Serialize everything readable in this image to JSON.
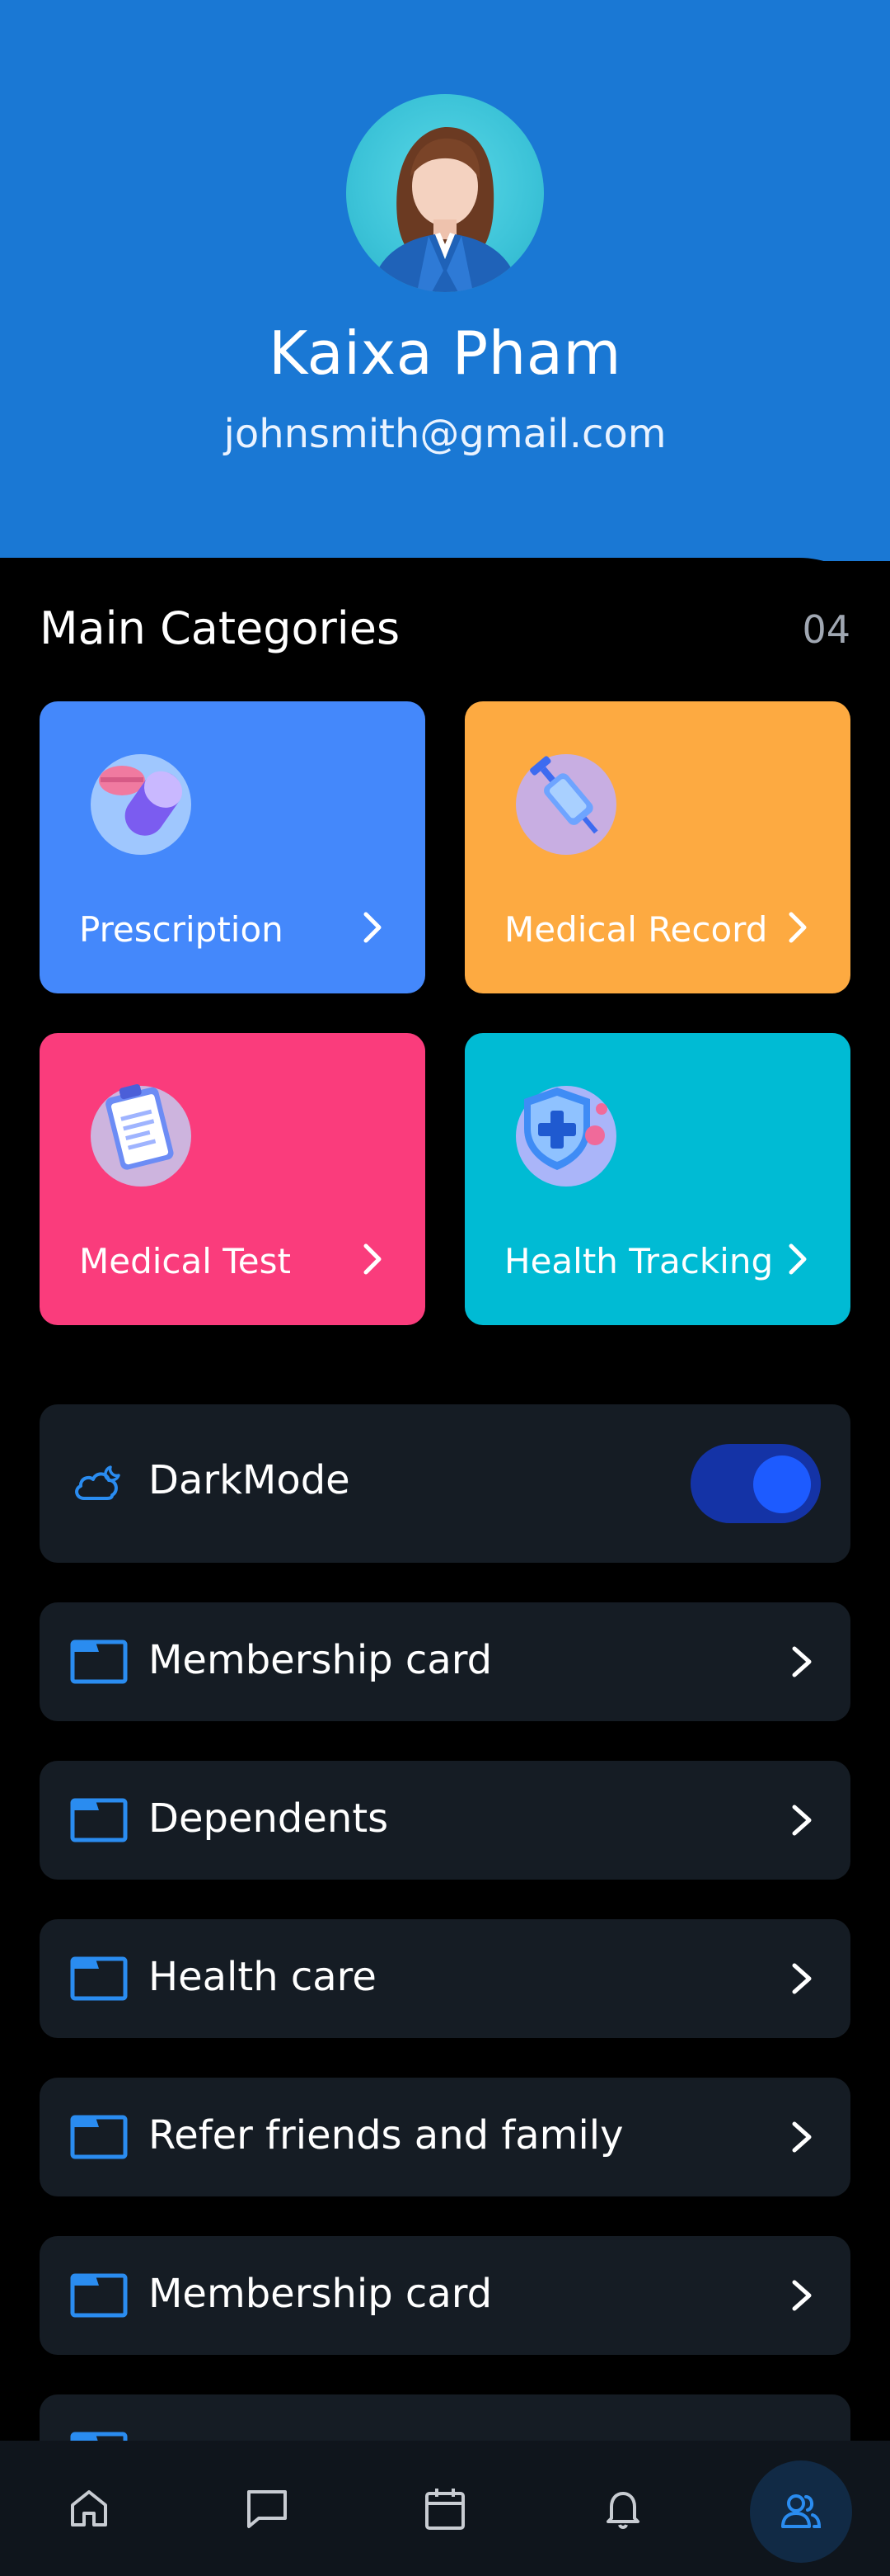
{
  "profile": {
    "name": "Kaixa Pham",
    "email": "johnsmith@gmail.com"
  },
  "categories": {
    "title": "Main Categories",
    "count": "04",
    "items": [
      {
        "label": "Prescription",
        "color": "#4488fb",
        "icon": "pills-icon"
      },
      {
        "label": "Medical Record",
        "color": "#fdaa41",
        "icon": "syringe-icon"
      },
      {
        "label": "Medical Test",
        "color": "#fa3c7c",
        "icon": "clipboard-icon"
      },
      {
        "label": "Health Tracking",
        "color": "#00bbd4",
        "icon": "shield-plus-icon"
      }
    ]
  },
  "settings": {
    "darkmode_label": "DarkMode",
    "darkmode_on": true,
    "items": [
      {
        "label": "Membership card",
        "icon": "folder-icon"
      },
      {
        "label": "Dependents",
        "icon": "folder-icon"
      },
      {
        "label": "Health care",
        "icon": "folder-icon"
      },
      {
        "label": "Refer friends and family",
        "icon": "folder-icon"
      },
      {
        "label": "Membership card",
        "icon": "folder-icon"
      }
    ]
  },
  "nav": {
    "items": [
      "home-icon",
      "chat-icon",
      "calendar-icon",
      "bell-icon",
      "profile-icon"
    ],
    "active": "profile-icon"
  },
  "colors": {
    "header_bg": "#1a78d4",
    "row_bg": "#151c24",
    "accent": "#2a8cf0"
  }
}
